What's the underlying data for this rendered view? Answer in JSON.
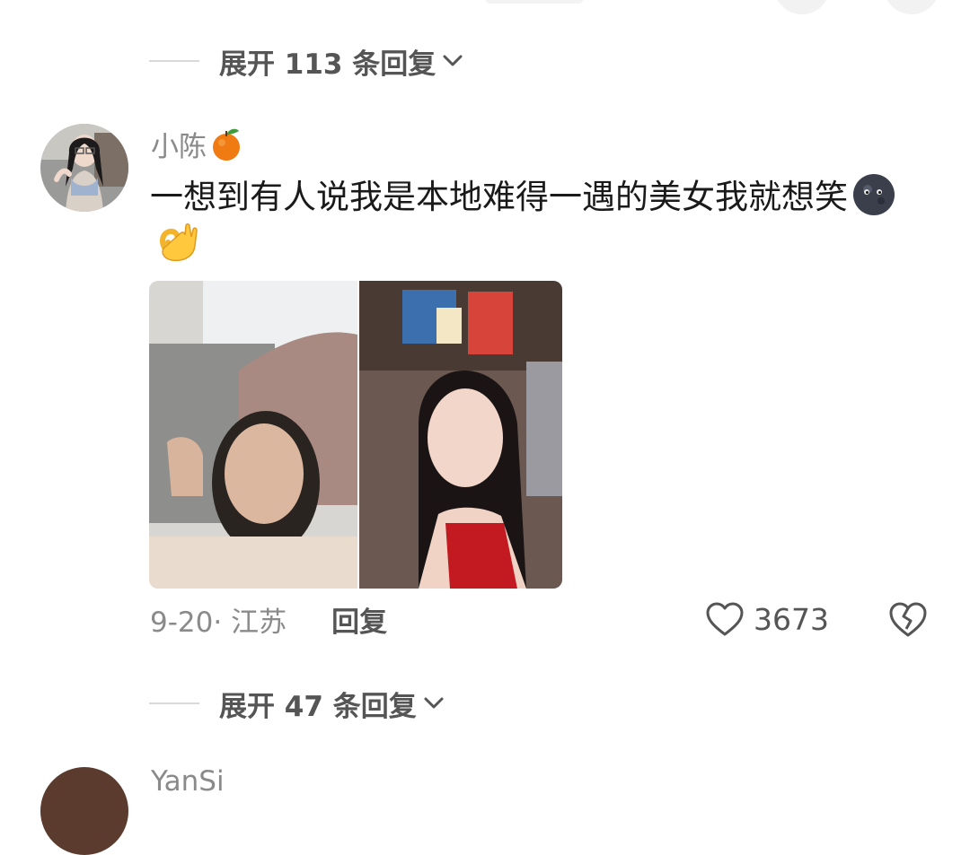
{
  "thread": {
    "expand_top": "展开 113 条回复",
    "expand_bottom": "展开 47 条回复"
  },
  "comment": {
    "username": "小陈",
    "username_icon": "tangerine-emoji",
    "text": "一想到有人说我是本地难得一遇的美女我就想笑",
    "trailing_emojis": [
      "new-moon-face-emoji",
      "ok-hand-emoji"
    ],
    "image_description_icon": "photo-attachment",
    "date": "9-20",
    "location": "江苏",
    "meta": "9-20· 江苏",
    "reply_label": "回复",
    "like_count": "3673"
  },
  "next_comment": {
    "username": "YanSi"
  },
  "colors": {
    "primary_text": "#1a1a1a",
    "secondary_text": "#8a8a8a",
    "divider": "#d9d9d9"
  }
}
